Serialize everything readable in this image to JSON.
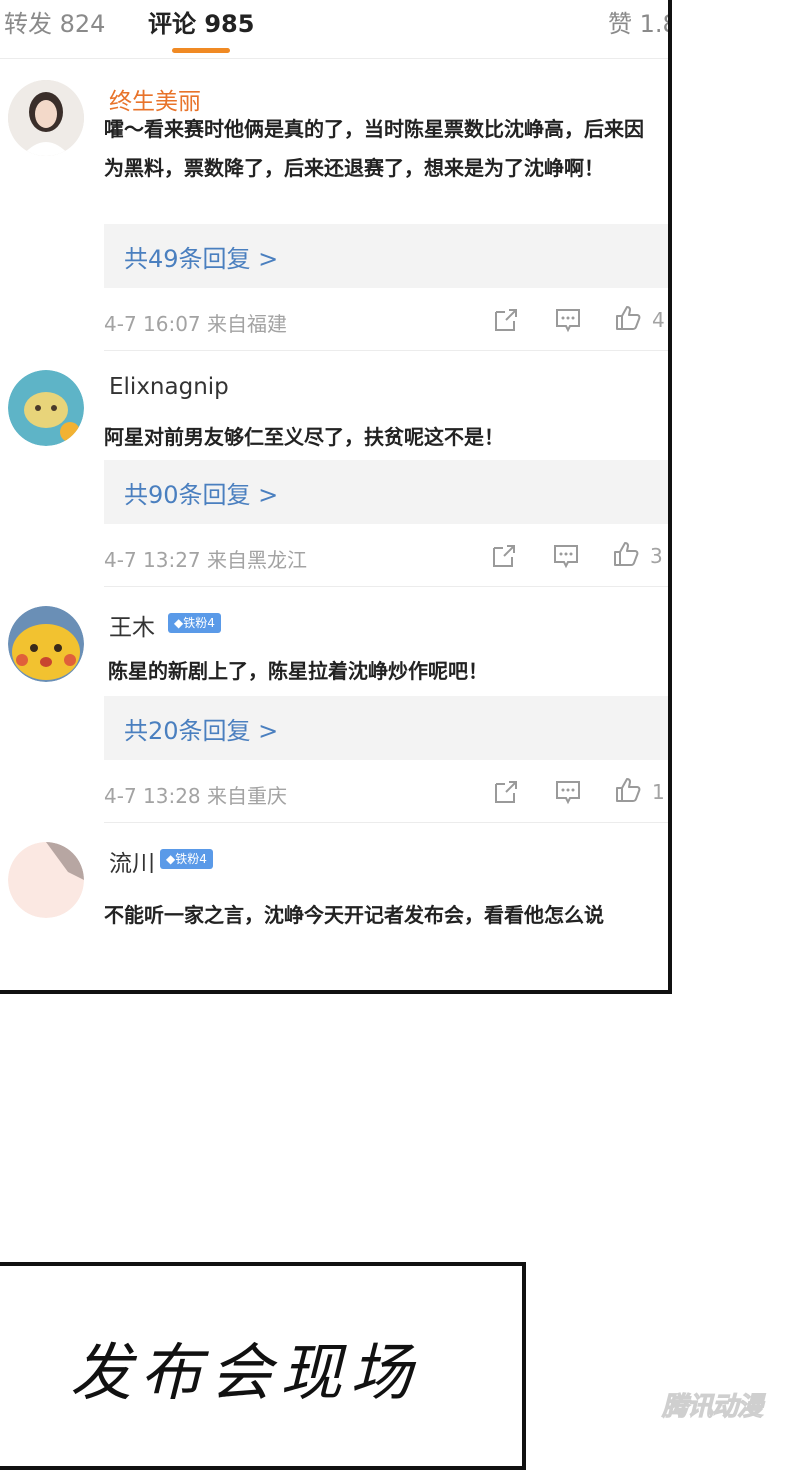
{
  "tabs": {
    "repost": "转发 824",
    "comments": "评论 985",
    "likes": "赞 1.8"
  },
  "comments": [
    {
      "username": "终生美丽",
      "text": "嚯～看来赛时他俩是真的了，当时陈星票数比沈峥高，后来因为黑料，票数降了，后来还退赛了，想来是为了沈峥啊！",
      "replies": "共49条回复 >",
      "meta": "4-7 16:07 来自福建",
      "likes": "4"
    },
    {
      "username": "Elixnagnip",
      "text": "阿星对前男友够仁至义尽了，扶贫呢这不是！",
      "replies": "共90条回复 >",
      "meta": "4-7 13:27 来自黑龙江",
      "likes": "3"
    },
    {
      "username": "王木",
      "badge": "◆铁粉4",
      "text": "陈星的新剧上了，陈星拉着沈峥炒作呢吧！",
      "replies": "共20条回复 >",
      "meta": "4-7 13:28 来自重庆",
      "likes": "1"
    },
    {
      "username": "流川",
      "badge": "◆铁粉4",
      "text": "不能听一家之言，沈峥今天开记者发布会，看看他怎么说"
    }
  ],
  "caption": "发布会现场",
  "watermark": "腾讯动漫",
  "colors": {
    "accent_tab": "#f08a24",
    "vip_name": "#e8732a",
    "reply_link": "#4a7fbf",
    "badge": "#5a9ae8"
  },
  "icons": [
    "share-icon",
    "comment-icon",
    "like-icon"
  ]
}
